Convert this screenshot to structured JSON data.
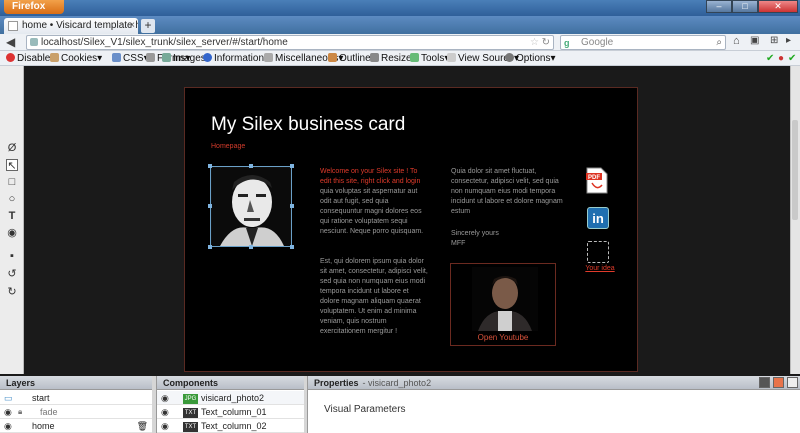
{
  "browser": {
    "app_button": "Firefox",
    "tab_title": "home • Visicard template html t...",
    "tab_close": "×",
    "new_tab": "+",
    "url": "localhost/Silex_V1/silex_trunk/silex_server/#/start/home",
    "search_placeholder": "Google",
    "search_engine": "g",
    "window_controls": {
      "minimize": "–",
      "maximize": "□",
      "close": "✕"
    }
  },
  "devtoolbar": {
    "items": [
      "Disable",
      "Cookies",
      "CSS",
      "Forms",
      "Images",
      "Information",
      "Miscellaneous",
      "Outline",
      "Resize",
      "Tools",
      "View Source",
      "Options"
    ]
  },
  "card": {
    "title": "My Silex business card",
    "home_link": "Homepage",
    "col1_lead": "Welcome on your Silex site ! To edit this site, right click and login",
    "col1_body": " quia voluptas sit aspernatur aut odit aut fugit, sed quia consequuntur magni dolores eos qui ratione voluptatem sequi nesciunt. Neque porro quisquam.",
    "col1_p2": "Est, qui dolorem ipsum quia dolor sit amet, consectetur, adipisci velit, sed quia non numquam eius modi tempora incidunt ut labore et dolore magnam aliquam quaerat voluptatem. Ut enim ad minima veniam, quis nostrum exercitationem mergitur !",
    "col2_body": "Quia dolor sit amet fluctuat, consectetur, adipisci velit, sed quia non numquam eius modi tempora incidunt ut labore et dolore magnam estum",
    "col2_sign": "Sincerely yours\nMFF",
    "video_caption": "Open Youtube",
    "idea_label": "Your idea",
    "linkedin": "in",
    "pdf": "PDF"
  },
  "layers": {
    "title": "Layers",
    "items": [
      {
        "label": "start"
      },
      {
        "label": "fade"
      },
      {
        "label": "home"
      }
    ]
  },
  "components": {
    "title": "Components",
    "items": [
      {
        "type": "JPG",
        "label": "visicard_photo2"
      },
      {
        "type": "TXT",
        "label": "Text_column_01"
      },
      {
        "type": "TXT",
        "label": "Text_column_02"
      }
    ]
  },
  "properties": {
    "title": "Properties",
    "subtitle": "- visicard_photo2",
    "section": "Visual Parameters"
  },
  "colors": {
    "accent_red": "#d23b2b",
    "card_bg": "#000000",
    "firefox_orange": "#e0802a"
  }
}
